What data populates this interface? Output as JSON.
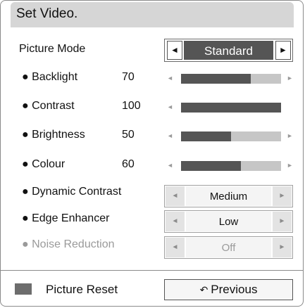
{
  "title": "Set Video.",
  "picture_mode": {
    "label": "Picture Mode",
    "value": "Standard",
    "left_arrow": "◄",
    "right_arrow": "►"
  },
  "sliders": [
    {
      "label": "● Backlight",
      "value": "70",
      "level": 0.7
    },
    {
      "label": "● Contrast",
      "value": "100",
      "level": 1.0
    },
    {
      "label": "● Brightness",
      "value": "50",
      "level": 0.5
    },
    {
      "label": "● Colour",
      "value": "60",
      "level": 0.6
    }
  ],
  "options": [
    {
      "label": "● Dynamic Contrast",
      "value": "Medium",
      "enabled": true
    },
    {
      "label": "● Edge Enhancer",
      "value": "Low",
      "enabled": true
    },
    {
      "label": "● Noise Reduction",
      "value": "Off",
      "enabled": false
    }
  ],
  "slider_arrows": {
    "left": "◄",
    "right": "►"
  },
  "footer": {
    "reset_label": "Picture Reset",
    "previous_label": "Previous",
    "previous_icon": "↶"
  }
}
